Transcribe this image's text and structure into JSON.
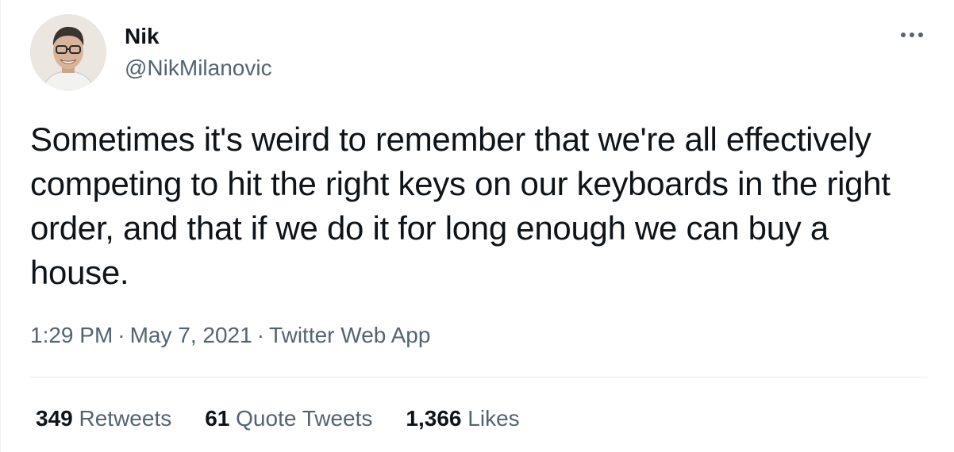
{
  "author": {
    "name": "Nik",
    "handle": "@NikMilanovic",
    "avatar_icon": "profile-photo-avatar"
  },
  "menu": {
    "more_icon": "more-horizontal-icon"
  },
  "tweet": {
    "text": "Sometimes it's weird to remember that we're all effectively competing to hit the right keys on our keyboards in the right order, and that if we do it for long enough we can buy a house.",
    "time": "1:29 PM",
    "separator": "·",
    "date": "May 7, 2021",
    "source": "Twitter Web App"
  },
  "stats": {
    "retweets_count": "349",
    "retweets_label": "Retweets",
    "quote_tweets_count": "61",
    "quote_tweets_label": "Quote Tweets",
    "likes_count": "1,366",
    "likes_label": "Likes"
  },
  "colors": {
    "text": "#0f1419",
    "secondary_text": "#536471",
    "divider": "#e6ecf0",
    "background": "#ffffff"
  }
}
